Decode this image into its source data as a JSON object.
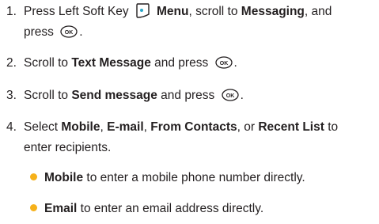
{
  "steps": [
    {
      "num": "1.",
      "t1": "Press Left Soft Key",
      "icon1": "left-soft-key-icon",
      "b1": "Menu",
      "t2": ", scroll to ",
      "b2": "Messaging",
      "t3": ", and",
      "line2_t1": "press",
      "icon2": "ok-key-icon",
      "line2_t2": "."
    },
    {
      "num": "2.",
      "t1": "Scroll to ",
      "b1": "Text Message",
      "t2": " and press",
      "icon1": "ok-key-icon",
      "t3": "."
    },
    {
      "num": "3.",
      "t1": "Scroll to ",
      "b1": "Send message",
      "t2": " and press",
      "icon1": "ok-key-icon",
      "t3": "."
    },
    {
      "num": "4.",
      "t1": "Select ",
      "b1": "Mobile",
      "t2": ", ",
      "b2": "E-mail",
      "t3": ", ",
      "b3": "From Contacts",
      "t4": ", or ",
      "b4": "Recent List",
      "t5": " to",
      "line2": "enter recipients."
    }
  ],
  "bullets": [
    {
      "b": "Mobile",
      "t": " to enter a mobile phone number directly."
    },
    {
      "b": "Email",
      "t": " to enter an email address directly."
    }
  ],
  "colors": {
    "text": "#231f20",
    "bullet": "#f6b11a"
  },
  "icons": {
    "ok_key_label": "OK"
  }
}
